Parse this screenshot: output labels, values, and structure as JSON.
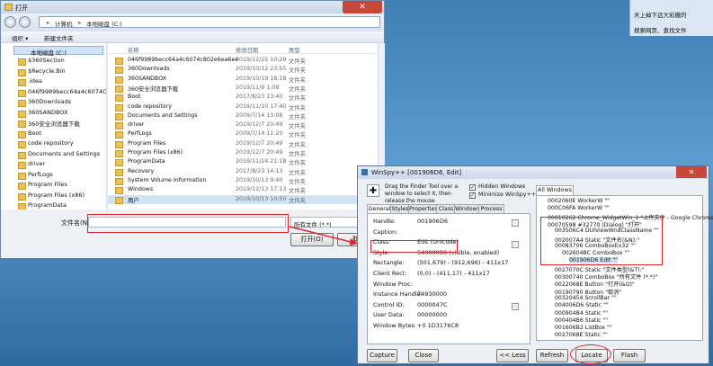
{
  "desktop": {
    "panel": {
      "item1": "天上掉下远大彩撒的",
      "item2": "搜索网页、查找文件"
    }
  },
  "explorer": {
    "title": "打开",
    "address": [
      "计算机",
      "本地磁盘 (C:)"
    ],
    "toolbar": {
      "organize": "组织 ▾",
      "new_folder": "新建文件夹"
    },
    "nav_selected": "本地磁盘 (C:)",
    "nav_items": [
      "$360Section",
      "$Recycle.Bin",
      ".idea",
      "046f9989becc64a4c6074C",
      "360Downloads",
      "360SANDBOX",
      "360安全浏览器下载",
      "Boot",
      "code repository",
      "Documents and Settings",
      "driver",
      "PerfLogs",
      "Program Files",
      "Program Files (x86)",
      "ProgramData"
    ],
    "columns": {
      "name": "名称",
      "date": "修改日期",
      "type": "类型"
    },
    "rows": [
      {
        "name": "046f9989becc64a4c6074c802e6ea6ee",
        "date": "2019/12/25 10:29",
        "type": "文件夹"
      },
      {
        "name": "360Downloads",
        "date": "2019/10/12 23:55",
        "type": "文件夹"
      },
      {
        "name": "360SANDBOX",
        "date": "2019/10/19 18:18",
        "type": "文件夹"
      },
      {
        "name": "360安全浏览器下载",
        "date": "2019/11/9 1:09",
        "type": "文件夹"
      },
      {
        "name": "Boot",
        "date": "2017/8/23 13:40",
        "type": "文件夹"
      },
      {
        "name": "code repository",
        "date": "2019/11/10 17:40",
        "type": "文件夹"
      },
      {
        "name": "Documents and Settings",
        "date": "2009/7/14 13:08",
        "type": "文件夹"
      },
      {
        "name": "driver",
        "date": "2019/12/7 20:49",
        "type": "文件夹"
      },
      {
        "name": "PerfLogs",
        "date": "2009/7/14 11:20",
        "type": "文件夹"
      },
      {
        "name": "Program Files",
        "date": "2019/12/7 20:49",
        "type": "文件夹"
      },
      {
        "name": "Program Files (x86)",
        "date": "2019/12/7 20:49",
        "type": "文件夹"
      },
      {
        "name": "ProgramData",
        "date": "2019/11/24 21:18",
        "type": "文件夹"
      },
      {
        "name": "Recovery",
        "date": "2017/8/23 14:13",
        "type": "文件夹"
      },
      {
        "name": "System Volume Information",
        "date": "2019/10/13 9:40",
        "type": "文件夹"
      },
      {
        "name": "Windows",
        "date": "2019/12/13 17:13",
        "type": "文件夹"
      },
      {
        "name": "用户",
        "date": "2019/10/13 10:50",
        "type": "文件夹"
      }
    ],
    "filename_label": "文件名(N):",
    "filename_value": "",
    "filetype_value": "所有文件 (*.*)",
    "open_button": "打开(O)",
    "cancel_button": "取消"
  },
  "spy": {
    "title": "WinSpy++ [001906D6, Edit]",
    "instruction": "Drag the Finder Tool over a window to select it, then release the mouse",
    "hidden_windows": "Hidden Windows",
    "minimize": "Minimize WinSpy++",
    "tabs": [
      "General",
      "Styles",
      "Properties",
      "Class",
      "Windows",
      "Process"
    ],
    "all_windows_tab": "All Windows",
    "fields": [
      {
        "label": "Handle:",
        "value": "001906D6"
      },
      {
        "label": "Caption:",
        "value": ""
      },
      {
        "label": "Class:",
        "value": "Edit  (Unicode)"
      },
      {
        "label": "Style:",
        "value": "54000080  (visible, enabled)"
      },
      {
        "label": "Rectangle:",
        "value": "(501,679) - (912,696)  -  411x17"
      },
      {
        "label": "Client Rect:",
        "value": "(0,0) - (411,17)  -  411x17"
      },
      {
        "label": "Window Proc:",
        "value": ""
      },
      {
        "label": "Instance Handle:",
        "value": "74930000"
      },
      {
        "label": "Control ID:",
        "value": "0000047C"
      },
      {
        "label": "User Data:",
        "value": "00000000"
      },
      {
        "label": "Window Bytes:",
        "value": "+0     1D3176C8"
      }
    ],
    "tree": [
      {
        "t": "0002060E  WorkerW  \"\"",
        "i": 1
      },
      {
        "t": "000C06FA  WorkerW  \"\"",
        "i": 1
      },
      {
        "t": "00010262  Chrome_WidgetWin_1  \"上传文件 - Google Chrome\"",
        "i": 1
      },
      {
        "t": "00070598  #32770 (Dialog)  \"打开\"",
        "i": 1
      },
      {
        "t": "003506C4  DUIViewWndClassName  \"\"",
        "i": 2
      },
      {
        "t": "002007A4  Static  \"文件名(&N):\"",
        "i": 2
      },
      {
        "t": "00083706  ComboBoxEx32  \"\"",
        "i": 2
      },
      {
        "t": "002604BC  ComboBox  \"\"",
        "i": 3
      },
      {
        "t": "001906D6  Edit  \"\"",
        "i": 4
      },
      {
        "t": "0027070C  Static  \"文件类型(&T):\"",
        "i": 2
      },
      {
        "t": "00300740  ComboBox  \"所有文件 (*.*)\"",
        "i": 2
      },
      {
        "t": "0022068E  Button  \"打开(&O)\"",
        "i": 2
      },
      {
        "t": "00190790  Button  \"取消\"",
        "i": 2
      },
      {
        "t": "00320454  ScrollBar  \"\"",
        "i": 2
      },
      {
        "t": "004006D6  Static  \"\"",
        "i": 2
      },
      {
        "t": "000904B4  Static  \"\"",
        "i": 2
      },
      {
        "t": "000404B6  Static  \"\"",
        "i": 2
      },
      {
        "t": "001606B2  ListBox  \"\"",
        "i": 2
      },
      {
        "t": "0027068E  Static  \"\"",
        "i": 2
      }
    ],
    "buttons": {
      "capture": "Capture",
      "close": "Close",
      "less": "<< Less",
      "refresh": "Refresh",
      "locate": "Locate",
      "flash": "Flash"
    }
  },
  "colors": {
    "highlight": "#e0232a",
    "accent": "#3f7fb6"
  }
}
